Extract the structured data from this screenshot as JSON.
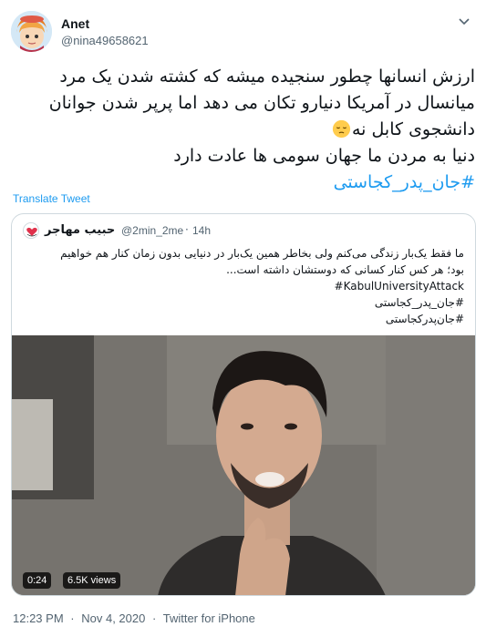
{
  "author": {
    "name": "Anet",
    "handle": "@nina49658621",
    "more_icon": "chevron-down-icon"
  },
  "tweet": {
    "line1": "ارزش انسانها چطور سنجیده میشه که کشته شدن یک مرد",
    "line2": "میانسال در آمریکا دنیارو تکان می دهد اما پرپر شدن جوانان",
    "line3": "دانشجوی کابل نه",
    "emoji": "pensive-face-emoji",
    "line4": "دنیا به مردن ما جهان سومی ها عادت دارد",
    "hashtag": "#جان_پدر_کجاستی"
  },
  "translate_label": "Translate Tweet",
  "quote": {
    "name": "حبیب مهاجر",
    "handle": "@2min_2me",
    "dot": "·",
    "time": "14h",
    "text_line1": "ما فقط یک‌بار زندگی می‌کنم ولی بخاطر همین یک‌بار در دنیایی بدون زمان کنار هم خواهیم",
    "text_line2": "بود؛ هر کس کنار کسانی که دوستشان داشته است...",
    "tag1": "#KabulUniversityAttack",
    "tag2": "#جان_پدر_کجاستی",
    "tag3": "#جان‌پدرکجاستی",
    "video": {
      "duration": "0:24",
      "views": "6.5K views"
    }
  },
  "footer": {
    "time": "12:23 PM",
    "sep": "·",
    "date": "Nov 4, 2020",
    "sep2": "·",
    "source": "Twitter for iPhone"
  },
  "colors": {
    "accent": "#1d9bf0",
    "secondary_text": "#536471",
    "border": "#cfd9de"
  }
}
